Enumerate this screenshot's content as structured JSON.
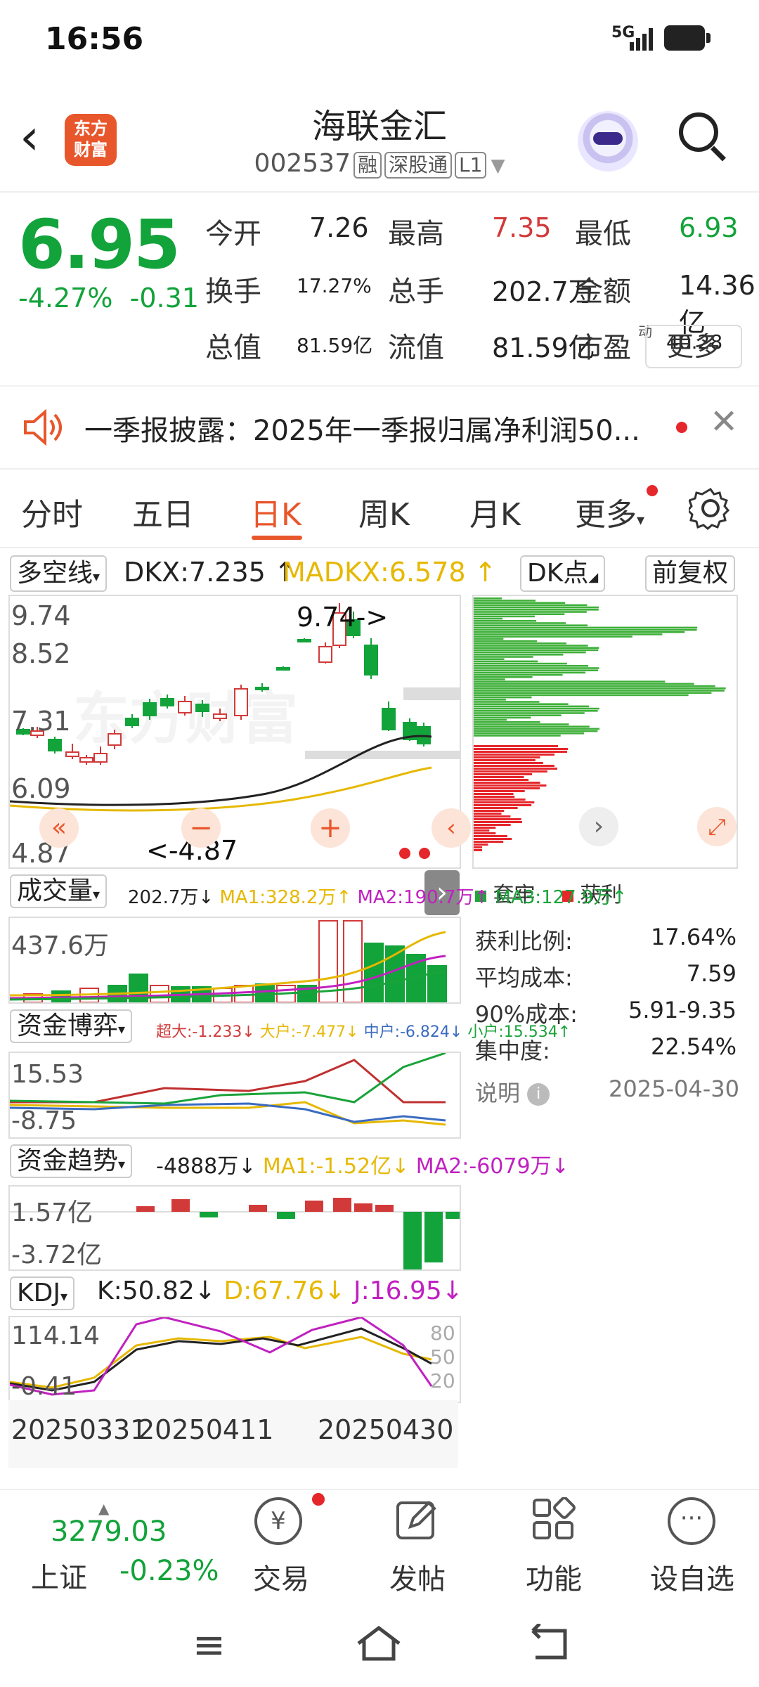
{
  "status_bar": {
    "time": "16:56",
    "network": "5G"
  },
  "header": {
    "back": "‹",
    "logo_text": "东方\n财富",
    "title": "海联金汇",
    "code": "002537",
    "tags": [
      "融",
      "深股通",
      "L1"
    ]
  },
  "quote": {
    "price": "6.95",
    "change_pct": "-4.27%",
    "change": "-0.31",
    "rows": [
      [
        {
          "label": "今开",
          "value": "7.26",
          "color": "#222222"
        },
        {
          "label": "最高",
          "value": "7.35",
          "color": "#d23a3a"
        },
        {
          "label": "最低",
          "value": "6.93",
          "color": "#12a33a"
        }
      ],
      [
        {
          "label": "换手",
          "value": "17.27%",
          "color": "#222222"
        },
        {
          "label": "总手",
          "value": "202.7万",
          "color": "#222222"
        },
        {
          "label": "金额",
          "value": "14.36亿",
          "color": "#222222"
        }
      ],
      [
        {
          "label": "总值",
          "value": "81.59亿",
          "color": "#222222"
        },
        {
          "label": "流值",
          "value": "81.59亿",
          "color": "#222222"
        },
        {
          "label": "市盈",
          "value": "40.28",
          "color": "#222222"
        }
      ]
    ],
    "pe_superscript": "动",
    "more_label": "更多"
  },
  "news": {
    "text": "一季报披露：2025年一季报归属净利润50..."
  },
  "tabs": [
    "分时",
    "五日",
    "日K",
    "周K",
    "月K",
    "更多"
  ],
  "active_tab": "日K",
  "kline": {
    "indicator": "多空线",
    "dkx": "DKX:7.235 ↑",
    "madkx": "MADKX:6.578 ↑",
    "dk_point": "DK点",
    "fq": "前复权",
    "y_labels": [
      "9.74",
      "8.52",
      "7.31",
      "6.09",
      "4.87"
    ],
    "max_label": "9.74->",
    "min_label": "<-4.87",
    "watermark": "东方财富"
  },
  "chip": {
    "legend_trapped": "套牢",
    "legend_profit": "获利",
    "stats": [
      {
        "label": "获利比例:",
        "value": "17.64%"
      },
      {
        "label": "平均成本:",
        "value": "7.59"
      },
      {
        "label": "90%成本:",
        "value": "5.91-9.35"
      },
      {
        "label": "集中度:",
        "value": "22.54%"
      }
    ],
    "note_label": "说明",
    "note_date": "2025-04-30"
  },
  "volume": {
    "title": "成交量",
    "legend": [
      {
        "text": "202.7万↓",
        "color": "#222222"
      },
      {
        "text": "MA1:328.2万↑",
        "color": "#e6b800"
      },
      {
        "text": "MA2:190.7万↑",
        "color": "#c021c0"
      },
      {
        "text": "MA3:127.9万↑",
        "color": "#1aa33a"
      }
    ],
    "y_label": "437.6万"
  },
  "fund_game": {
    "title": "资金博弈",
    "legend": [
      {
        "text": "超大:-1.233↓",
        "color": "#d23a3a"
      },
      {
        "text": "大户:-7.477↓",
        "color": "#e6b800"
      },
      {
        "text": "中户:-6.824↓",
        "color": "#3a6bc0"
      },
      {
        "text": "小户:15.534↑",
        "color": "#1aa33a"
      }
    ],
    "y_labels": [
      "15.53",
      "-8.75"
    ]
  },
  "fund_trend": {
    "title": "资金趋势",
    "legend": [
      {
        "text": "-4888万↓",
        "color": "#222222"
      },
      {
        "text": "MA1:-1.52亿↓",
        "color": "#e6b800"
      },
      {
        "text": "MA2:-6079万↓",
        "color": "#c021c0"
      }
    ],
    "y_labels": [
      "1.57亿",
      "-3.72亿"
    ]
  },
  "kdj": {
    "title": "KDJ",
    "k": "K:50.82↓",
    "d": "D:67.76↓",
    "j": "J:16.95↓",
    "y_labels": [
      "114.14",
      "-0.41"
    ],
    "right_labels": [
      "80",
      "50",
      "20"
    ]
  },
  "x_axis": [
    "20250331",
    "20250411",
    "20250430"
  ],
  "bottom_nav": {
    "index_value": "3279.03",
    "index_name": "上证",
    "index_change": "-0.23%",
    "items": [
      "交易",
      "发帖",
      "功能",
      "设自选"
    ]
  },
  "colors": {
    "up": "#d23a3a",
    "down": "#12a33a",
    "accent": "#e8562b"
  }
}
